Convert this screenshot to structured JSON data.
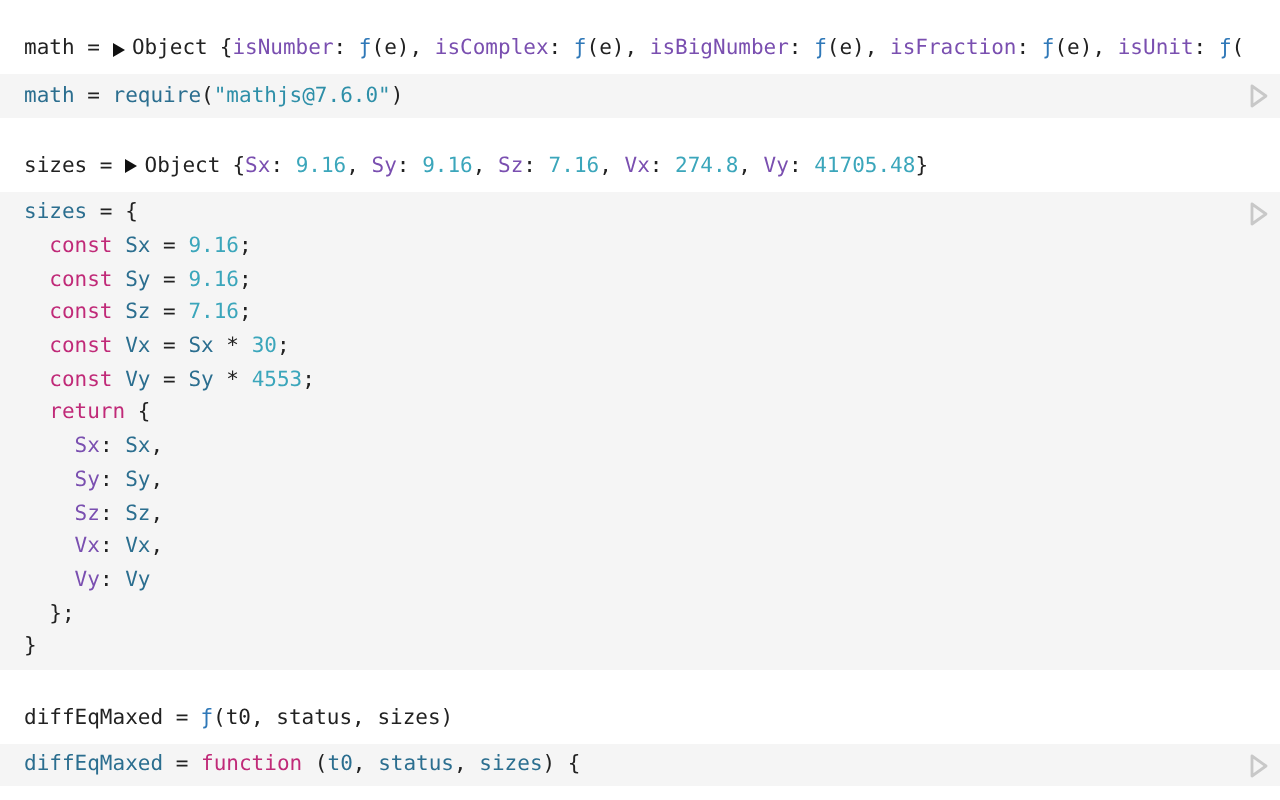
{
  "cells": [
    {
      "output": {
        "head": "math =",
        "expanded": false,
        "type": "Object",
        "tokens": [
          {
            "t": "{",
            "kind": "plain"
          },
          {
            "t": "isNumber",
            "kind": "prop"
          },
          {
            "t": ":",
            "kind": "plain"
          },
          {
            "t": " ƒ",
            "kind": "fn"
          },
          {
            "t": "(e),",
            "kind": "plain"
          },
          {
            "t": " isComplex",
            "kind": "prop"
          },
          {
            "t": ":",
            "kind": "plain"
          },
          {
            "t": " ƒ",
            "kind": "fn"
          },
          {
            "t": "(e),",
            "kind": "plain"
          },
          {
            "t": " isBigNumber",
            "kind": "prop"
          },
          {
            "t": ":",
            "kind": "plain"
          },
          {
            "t": " ƒ",
            "kind": "fn"
          },
          {
            "t": "(e),",
            "kind": "plain"
          },
          {
            "t": " isFraction",
            "kind": "prop"
          },
          {
            "t": ":",
            "kind": "plain"
          },
          {
            "t": " ƒ",
            "kind": "fn"
          },
          {
            "t": "(e),",
            "kind": "plain"
          },
          {
            "t": " isUnit",
            "kind": "prop"
          },
          {
            "t": ":",
            "kind": "plain"
          },
          {
            "t": " ƒ",
            "kind": "fn"
          },
          {
            "t": "(",
            "kind": "plain"
          }
        ]
      },
      "code": [
        [
          {
            "t": "math",
            "kind": "var"
          },
          {
            "t": " = ",
            "kind": "plain"
          },
          {
            "t": "require",
            "kind": "var"
          },
          {
            "t": "(",
            "kind": "plain"
          },
          {
            "t": "\"mathjs@7.6.0\"",
            "kind": "string"
          },
          {
            "t": ")",
            "kind": "plain"
          }
        ]
      ]
    },
    {
      "output": {
        "head": "sizes =",
        "expanded": false,
        "type": "Object",
        "tokens": [
          {
            "t": "{",
            "kind": "plain"
          },
          {
            "t": "Sx",
            "kind": "prop"
          },
          {
            "t": ":",
            "kind": "plain"
          },
          {
            "t": " 9.16",
            "kind": "number"
          },
          {
            "t": ",",
            "kind": "plain"
          },
          {
            "t": " Sy",
            "kind": "prop"
          },
          {
            "t": ":",
            "kind": "plain"
          },
          {
            "t": " 9.16",
            "kind": "number"
          },
          {
            "t": ",",
            "kind": "plain"
          },
          {
            "t": " Sz",
            "kind": "prop"
          },
          {
            "t": ":",
            "kind": "plain"
          },
          {
            "t": " 7.16",
            "kind": "number"
          },
          {
            "t": ",",
            "kind": "plain"
          },
          {
            "t": " Vx",
            "kind": "prop"
          },
          {
            "t": ":",
            "kind": "plain"
          },
          {
            "t": " 274.8",
            "kind": "number"
          },
          {
            "t": ",",
            "kind": "plain"
          },
          {
            "t": " Vy",
            "kind": "prop"
          },
          {
            "t": ":",
            "kind": "plain"
          },
          {
            "t": " 41705.48",
            "kind": "number"
          },
          {
            "t": "}",
            "kind": "plain"
          }
        ]
      },
      "code": [
        [
          {
            "t": "sizes",
            "kind": "var"
          },
          {
            "t": " = {",
            "kind": "plain"
          }
        ],
        [
          {
            "t": "  const",
            "kind": "keyword"
          },
          {
            "t": " Sx",
            "kind": "var"
          },
          {
            "t": " = ",
            "kind": "plain"
          },
          {
            "t": "9.16",
            "kind": "number"
          },
          {
            "t": ";",
            "kind": "plain"
          }
        ],
        [
          {
            "t": "  const",
            "kind": "keyword"
          },
          {
            "t": " Sy",
            "kind": "var"
          },
          {
            "t": " = ",
            "kind": "plain"
          },
          {
            "t": "9.16",
            "kind": "number"
          },
          {
            "t": ";",
            "kind": "plain"
          }
        ],
        [
          {
            "t": "  const",
            "kind": "keyword"
          },
          {
            "t": " Sz",
            "kind": "var"
          },
          {
            "t": " = ",
            "kind": "plain"
          },
          {
            "t": "7.16",
            "kind": "number"
          },
          {
            "t": ";",
            "kind": "plain"
          }
        ],
        [
          {
            "t": "  const",
            "kind": "keyword"
          },
          {
            "t": " Vx",
            "kind": "var"
          },
          {
            "t": " = ",
            "kind": "plain"
          },
          {
            "t": "Sx",
            "kind": "var"
          },
          {
            "t": " * ",
            "kind": "plain"
          },
          {
            "t": "30",
            "kind": "number"
          },
          {
            "t": ";",
            "kind": "plain"
          }
        ],
        [
          {
            "t": "  const",
            "kind": "keyword"
          },
          {
            "t": " Vy",
            "kind": "var"
          },
          {
            "t": " = ",
            "kind": "plain"
          },
          {
            "t": "Sy",
            "kind": "var"
          },
          {
            "t": " * ",
            "kind": "plain"
          },
          {
            "t": "4553",
            "kind": "number"
          },
          {
            "t": ";",
            "kind": "plain"
          }
        ],
        [
          {
            "t": "  return",
            "kind": "keyword"
          },
          {
            "t": " {",
            "kind": "plain"
          }
        ],
        [
          {
            "t": "    Sx",
            "kind": "prop"
          },
          {
            "t": ": ",
            "kind": "plain"
          },
          {
            "t": "Sx",
            "kind": "var"
          },
          {
            "t": ",",
            "kind": "plain"
          }
        ],
        [
          {
            "t": "    Sy",
            "kind": "prop"
          },
          {
            "t": ": ",
            "kind": "plain"
          },
          {
            "t": "Sy",
            "kind": "var"
          },
          {
            "t": ",",
            "kind": "plain"
          }
        ],
        [
          {
            "t": "    Sz",
            "kind": "prop"
          },
          {
            "t": ": ",
            "kind": "plain"
          },
          {
            "t": "Sz",
            "kind": "var"
          },
          {
            "t": ",",
            "kind": "plain"
          }
        ],
        [
          {
            "t": "    Vx",
            "kind": "prop"
          },
          {
            "t": ": ",
            "kind": "plain"
          },
          {
            "t": "Vx",
            "kind": "var"
          },
          {
            "t": ",",
            "kind": "plain"
          }
        ],
        [
          {
            "t": "    Vy",
            "kind": "prop"
          },
          {
            "t": ": ",
            "kind": "plain"
          },
          {
            "t": "Vy",
            "kind": "var"
          }
        ],
        [
          {
            "t": "  };",
            "kind": "plain"
          }
        ],
        [
          {
            "t": "}",
            "kind": "plain"
          }
        ]
      ]
    },
    {
      "output": {
        "head": "diffEqMaxed =",
        "tokens": [
          {
            "t": "ƒ",
            "kind": "fn"
          },
          {
            "t": "(t0, status, sizes)",
            "kind": "plain"
          }
        ]
      },
      "code": [
        [
          {
            "t": "diffEqMaxed",
            "kind": "var"
          },
          {
            "t": " = ",
            "kind": "plain"
          },
          {
            "t": "function",
            "kind": "keyword"
          },
          {
            "t": " (",
            "kind": "plain"
          },
          {
            "t": "t0",
            "kind": "var"
          },
          {
            "t": ", ",
            "kind": "plain"
          },
          {
            "t": "status",
            "kind": "var"
          },
          {
            "t": ", ",
            "kind": "plain"
          },
          {
            "t": "sizes",
            "kind": "var"
          },
          {
            "t": ") {",
            "kind": "plain"
          }
        ]
      ]
    }
  ]
}
